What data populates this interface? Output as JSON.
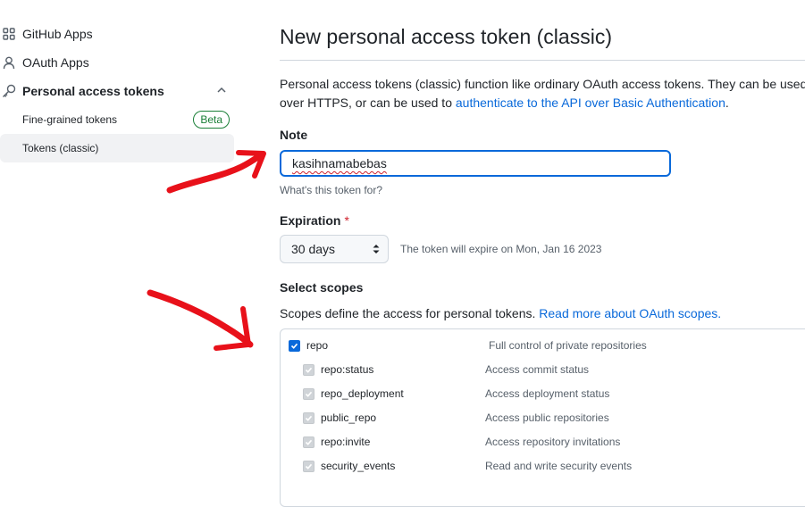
{
  "sidebar": {
    "items": [
      {
        "label": "GitHub Apps",
        "icon": "apps-grid-icon"
      },
      {
        "label": "OAuth Apps",
        "icon": "person-icon"
      },
      {
        "label": "Personal access tokens",
        "icon": "key-icon"
      }
    ],
    "sub_items": [
      {
        "label": "Fine-grained tokens",
        "badge": "Beta"
      },
      {
        "label": "Tokens (classic)"
      }
    ]
  },
  "page": {
    "title": "New personal access token (classic)",
    "description_start": "Personal access tokens (classic) function like ordinary OAuth access tokens. They can be used in",
    "description_mid": "over HTTPS, or can be used to ",
    "description_link": "authenticate to the API over Basic Authentication",
    "description_end": "."
  },
  "note": {
    "label": "Note",
    "value": "kasihnamabebas",
    "hint": "What's this token for?"
  },
  "expiration": {
    "label": "Expiration",
    "required_mark": "*",
    "selected": "30 days",
    "info": "The token will expire on Mon, Jan 16 2023"
  },
  "scopes": {
    "label": "Select scopes",
    "description": "Scopes define the access for personal tokens. ",
    "link": "Read more about OAuth scopes.",
    "items": [
      {
        "name": "repo",
        "desc": "Full control of private repositories"
      },
      {
        "name": "repo:status",
        "desc": "Access commit status"
      },
      {
        "name": "repo_deployment",
        "desc": "Access deployment status"
      },
      {
        "name": "public_repo",
        "desc": "Access public repositories"
      },
      {
        "name": "repo:invite",
        "desc": "Access repository invitations"
      },
      {
        "name": "security_events",
        "desc": "Read and write security events"
      }
    ]
  },
  "colors": {
    "accent": "#0969da",
    "beta_green": "#1a7f37",
    "required_red": "#cf222e",
    "annotation_red": "#e8111a"
  }
}
